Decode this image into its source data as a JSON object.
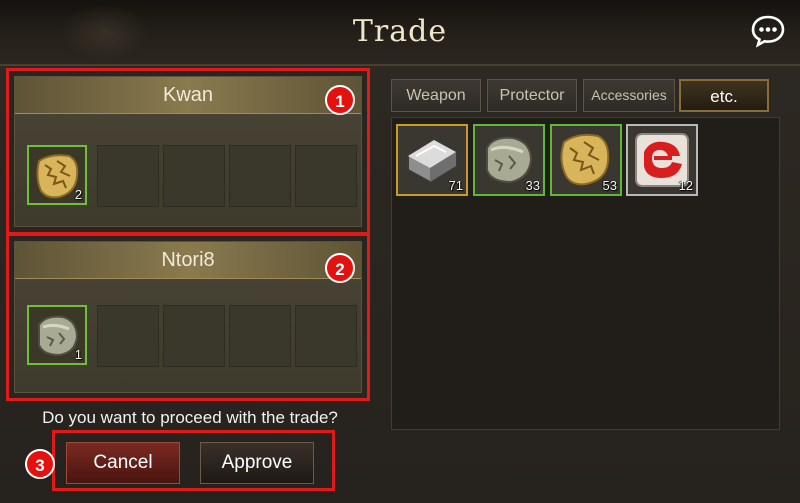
{
  "title": "Trade",
  "chat_icon": "chat-bubble-icon",
  "parties": [
    {
      "name": "Kwan",
      "badge": "1",
      "slots": [
        {
          "item": "gold-ore-icon",
          "count": "2"
        },
        {
          "item": null,
          "count": ""
        },
        {
          "item": null,
          "count": ""
        },
        {
          "item": null,
          "count": ""
        },
        {
          "item": null,
          "count": ""
        }
      ]
    },
    {
      "name": "Ntori8",
      "badge": "2",
      "slots": [
        {
          "item": "stone-ore-icon",
          "count": "1"
        },
        {
          "item": null,
          "count": ""
        },
        {
          "item": null,
          "count": ""
        },
        {
          "item": null,
          "count": ""
        },
        {
          "item": null,
          "count": ""
        }
      ]
    }
  ],
  "question": "Do you want to proceed with the trade?",
  "buttons": {
    "cancel": "Cancel",
    "approve": "Approve",
    "badge": "3"
  },
  "tabs": [
    {
      "label": "Weapon",
      "active": false
    },
    {
      "label": "Protector",
      "active": false
    },
    {
      "label": "Accessories",
      "active": false
    },
    {
      "label": "etc.",
      "active": true
    }
  ],
  "inventory": [
    {
      "item": "silver-ingot-icon",
      "count": "71",
      "rarity": "gold"
    },
    {
      "item": "stone-ore-icon",
      "count": "33",
      "rarity": "green"
    },
    {
      "item": "gold-ore-icon",
      "count": "53",
      "rarity": "green"
    },
    {
      "item": "red-scroll-icon",
      "count": "12",
      "rarity": "white"
    }
  ],
  "colors": {
    "highlight": "#e01a1a",
    "green_border": "#6fbf3a",
    "gold_border": "#c79a2e"
  }
}
